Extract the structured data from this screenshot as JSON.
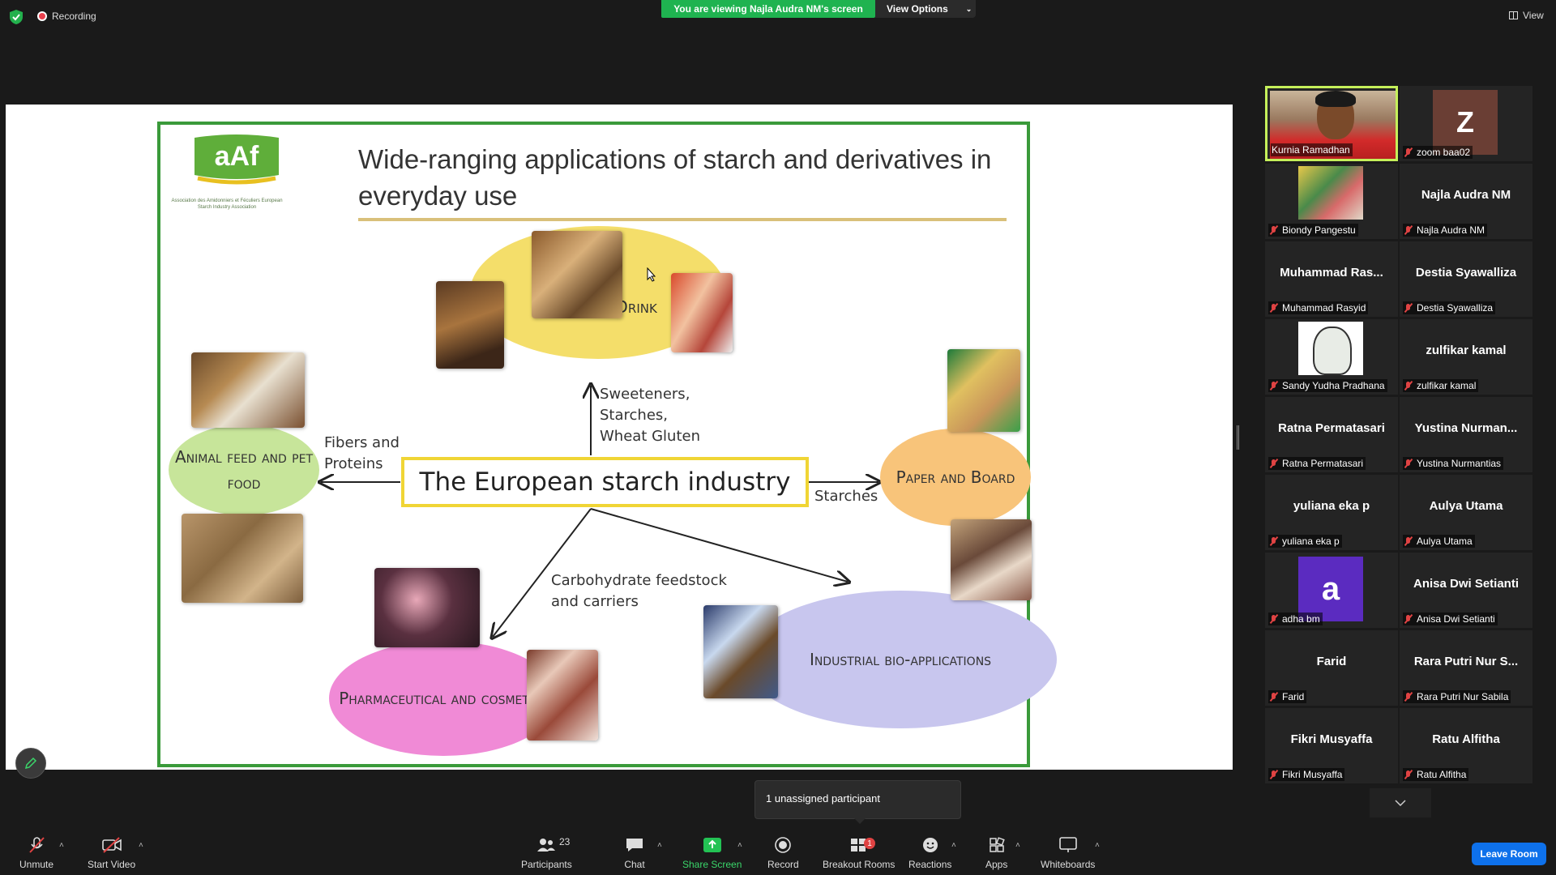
{
  "topbar": {
    "recording_label": "Recording",
    "share_banner": "You are viewing Najla Audra NM's screen",
    "view_options_label": "View Options",
    "view_label": "View"
  },
  "slide": {
    "title": "Wide-ranging applications of starch and derivatives in everyday use",
    "logo_text": "aAf",
    "logo_subtitle": "Association des Amidonniers et Féculiers European Starch Industry Association",
    "center": "The European starch industry",
    "nodes": {
      "food": "Food and Drink",
      "animal": "Animal feed and pet food",
      "paper": "Paper and Board",
      "pharma": "Pharmaceutical and cosmetics",
      "industrial": "Industrial bio-applications"
    },
    "arrow_labels": {
      "sweeteners": [
        "Sweeteners,",
        "Starches,",
        "Wheat Gluten"
      ],
      "fibers": [
        "Fibers and",
        "Proteins"
      ],
      "starches": "Starches",
      "carbohydrate": [
        "Carbohydrate feedstock",
        "and carriers"
      ]
    }
  },
  "participants": [
    {
      "name": "Kurnia Ramadhan",
      "video": true,
      "active": true
    },
    {
      "name": "zoom baa02",
      "initial": "Z"
    },
    {
      "name": "Biondy Pangestu",
      "photo": true
    },
    {
      "name": "Najla Audra NM",
      "big": "Najla Audra NM"
    },
    {
      "name": "Muhammad Rasyid",
      "big": "Muhammad Ras..."
    },
    {
      "name": "Destia Syawalliza",
      "big": "Destia Syawalliza"
    },
    {
      "name": "Sandy Yudha Pradhana",
      "bear": true
    },
    {
      "name": "zulfikar kamal",
      "big": "zulfikar kamal"
    },
    {
      "name": "Ratna Permatasari",
      "big": "Ratna Permatasari"
    },
    {
      "name": "Yustina Nurmantias",
      "big": "Yustina  Nurman..."
    },
    {
      "name": "yuliana eka p",
      "big": "yuliana eka p"
    },
    {
      "name": "Aulya Utama",
      "big": "Aulya Utama"
    },
    {
      "name": "adha bm",
      "initial": "a"
    },
    {
      "name": "Anisa Dwi Setianti",
      "big": "Anisa Dwi Setianti"
    },
    {
      "name": "Farid",
      "big": "Farid"
    },
    {
      "name": "Rara Putri Nur Sabila",
      "big": "Rara Putri Nur S..."
    },
    {
      "name": "Fikri Musyaffa",
      "big": "Fikri Musyaffa"
    },
    {
      "name": "Ratu Alfitha",
      "big": "Ratu Alfitha"
    }
  ],
  "toast": "1 unassigned participant",
  "toolbar": {
    "unmute": "Unmute",
    "start_video": "Start Video",
    "participants": "Participants",
    "participants_count": "23",
    "chat": "Chat",
    "share_screen": "Share Screen",
    "record": "Record",
    "breakout_rooms": "Breakout Rooms",
    "breakout_badge": "1",
    "reactions": "Reactions",
    "apps": "Apps",
    "whiteboards": "Whiteboards",
    "leave_room": "Leave Room"
  },
  "colors": {
    "share_banner": "#1fb350",
    "leave_button": "#0e71eb",
    "active_speaker": "#c5f05a",
    "muted": "#e04343"
  }
}
